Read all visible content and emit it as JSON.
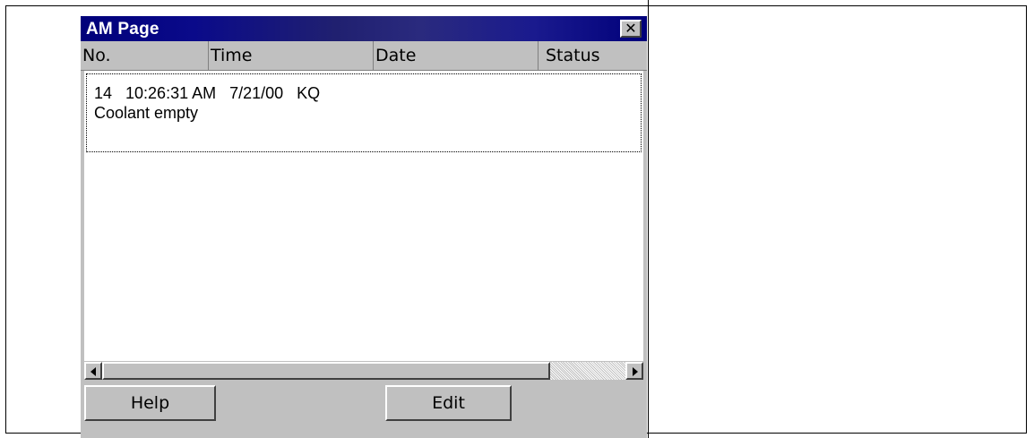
{
  "window": {
    "title": "AM Page",
    "close_icon": "close-icon"
  },
  "columns": [
    "No.",
    "Time",
    "Date",
    "Status"
  ],
  "rows": [
    {
      "line1": "14   10:26:31 AM   7/21/00   KQ",
      "line2": "Coolant empty"
    }
  ],
  "buttons": {
    "help": "Help",
    "edit": "Edit"
  },
  "scrollbar": {
    "left_icon": "arrow-left-icon",
    "right_icon": "arrow-right-icon"
  },
  "colors": {
    "titlebar": "#00007a",
    "face": "#c0c0c0"
  }
}
